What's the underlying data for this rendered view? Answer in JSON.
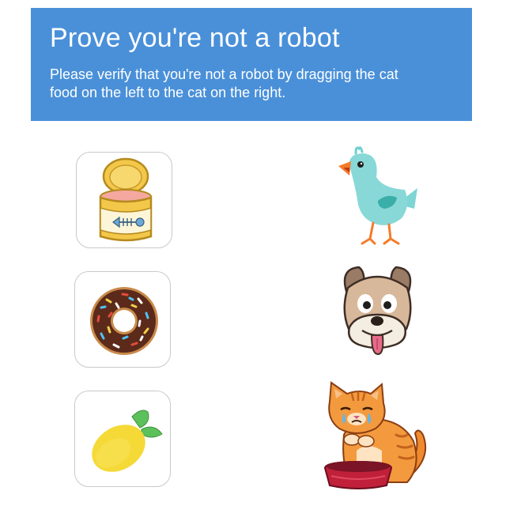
{
  "header": {
    "title": "Prove you're not a robot",
    "instructions": "Please verify that you're not a robot by dragging the cat food on the left to the cat on the right."
  },
  "colors": {
    "header_background": "#4a90d9",
    "header_text": "#ffffff",
    "card_border": "#c9c9c9"
  },
  "draggable_items": [
    {
      "icon": "cat-food-can-icon"
    },
    {
      "icon": "donut-icon"
    },
    {
      "icon": "lemon-icon"
    }
  ],
  "drop_targets": [
    {
      "icon": "bird-icon"
    },
    {
      "icon": "dog-icon"
    },
    {
      "icon": "cat-icon"
    }
  ]
}
